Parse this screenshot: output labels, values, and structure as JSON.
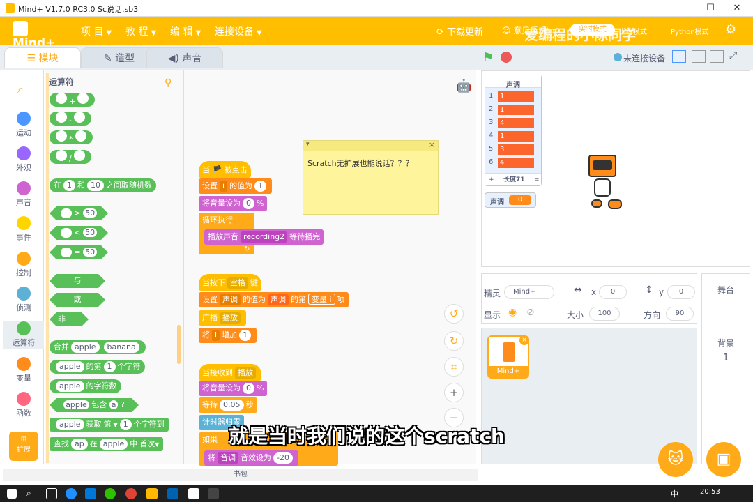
{
  "window": {
    "title": "Mind+ V1.7.0 RC3.0   Sc说话.sb3",
    "min": "—",
    "max": "☐",
    "close": "✕"
  },
  "menubar": {
    "logo": "Mind+",
    "items": [
      "项 目",
      "教 程",
      "编 辑",
      "连接设备"
    ],
    "right": [
      "下载更新",
      "意见反馈",
      "实时模式",
      "上传模式",
      "Python模式"
    ],
    "watermark": "爱编程的小陈同学"
  },
  "tabs": [
    "模块",
    "造型",
    "声音"
  ],
  "stage_controls": {
    "device_status": "未连接设备"
  },
  "categories": [
    {
      "label": "运动",
      "color": "#4c97ff"
    },
    {
      "label": "外观",
      "color": "#9966ff"
    },
    {
      "label": "声音",
      "color": "#cf63cf"
    },
    {
      "label": "事件",
      "color": "#ffd500"
    },
    {
      "label": "控制",
      "color": "#ffab19"
    },
    {
      "label": "侦测",
      "color": "#5cb1d6"
    },
    {
      "label": "运算符",
      "color": "#59c059"
    },
    {
      "label": "变量",
      "color": "#ff8c1a"
    },
    {
      "label": "函数",
      "color": "#ff6680"
    }
  ],
  "extensions_label": "扩展",
  "palette": {
    "title": "运算符",
    "ops": [
      "+",
      "-",
      "*",
      "/"
    ],
    "random": {
      "pre": "在",
      "a": "1",
      "mid": "和",
      "b": "10",
      "post": "之间取随机数"
    },
    "cmp": [
      {
        "op": ">",
        "v": "50"
      },
      {
        "op": "<",
        "v": "50"
      },
      {
        "op": "=",
        "v": "50"
      }
    ],
    "logic": [
      "与",
      "或",
      "非"
    ],
    "join": {
      "label": "合并",
      "a": "apple",
      "b": "banana"
    },
    "letter": {
      "a": "apple",
      "mid": "的第",
      "n": "1",
      "post": "个字符"
    },
    "length": {
      "a": "apple",
      "post": "的字符数"
    },
    "contains": {
      "a": "apple",
      "mid": "包含",
      "b": "a",
      "post": "?"
    },
    "getchar": {
      "a": "apple",
      "mid": "获取",
      "d": "第",
      "n": "1",
      "post": "个字符到"
    },
    "find": {
      "pre": "查找",
      "a": "ap",
      "mid": "在",
      "b": "apple",
      "mid2": "中",
      "d": "首次"
    }
  },
  "scripts": {
    "s1": {
      "hat": "当 🏴 被点击",
      "set": {
        "pre": "设置",
        "var": "i",
        "mid": "的值为",
        "v": "1"
      },
      "vol": {
        "pre": "将音量设为",
        "v": "0",
        "post": "%"
      },
      "loop": "循环执行",
      "play": {
        "pre": "播放声音",
        "snd": "recording2",
        "post": "等待播完"
      }
    },
    "s2": {
      "hat": {
        "pre": "当按下",
        "key": "空格",
        "post": "键"
      },
      "set": {
        "pre": "设置",
        "var": "声调",
        "mid": "的值为",
        "list": "声调",
        "mid2": "的第",
        "idx": "变量 i",
        "post": "项"
      },
      "bcast": {
        "pre": "广播",
        "msg": "播放"
      },
      "inc": {
        "pre": "将",
        "var": "i",
        "mid": "增加",
        "v": "1"
      }
    },
    "s3": {
      "hat": {
        "pre": "当接收到",
        "msg": "播放"
      },
      "vol": {
        "pre": "将音量设为",
        "v": "0",
        "post": "%"
      },
      "wait": {
        "pre": "等待",
        "v": "0.05",
        "post": "秒"
      },
      "timer": "计时器归零",
      "if": "如果",
      "effect": {
        "pre": "将",
        "eff": "音调",
        "mid": "音效设为",
        "v": "-20"
      }
    }
  },
  "note": {
    "text": "Scratch无扩展也能说话？？？",
    "collapse": "▾",
    "close": "×"
  },
  "backpack": "书包",
  "list_monitor": {
    "title": "声调",
    "rows": [
      {
        "n": "1",
        "v": "1"
      },
      {
        "n": "2",
        "v": "1"
      },
      {
        "n": "3",
        "v": "4"
      },
      {
        "n": "4",
        "v": "1"
      },
      {
        "n": "5",
        "v": "3"
      },
      {
        "n": "6",
        "v": "4"
      }
    ],
    "add": "+",
    "length": "长度71",
    "eq": "="
  },
  "var_monitor": {
    "label": "声调",
    "value": "0"
  },
  "sprite_info": {
    "sprite_label": "精灵",
    "sprite_name": "Mind+",
    "x_label": "x",
    "x": "0",
    "y_label": "y",
    "y": "0",
    "show_label": "显示",
    "size_label": "大小",
    "size": "100",
    "dir_label": "方向",
    "dir": "90"
  },
  "sprite_thumb": {
    "name": "Mind+"
  },
  "stage_panel": {
    "title": "舞台",
    "backdrop_label": "背景",
    "backdrop_count": "1"
  },
  "subtitle": "就是当时我们说的这个scratch",
  "taskbar": {
    "time": "20:53",
    "ime": "中"
  }
}
